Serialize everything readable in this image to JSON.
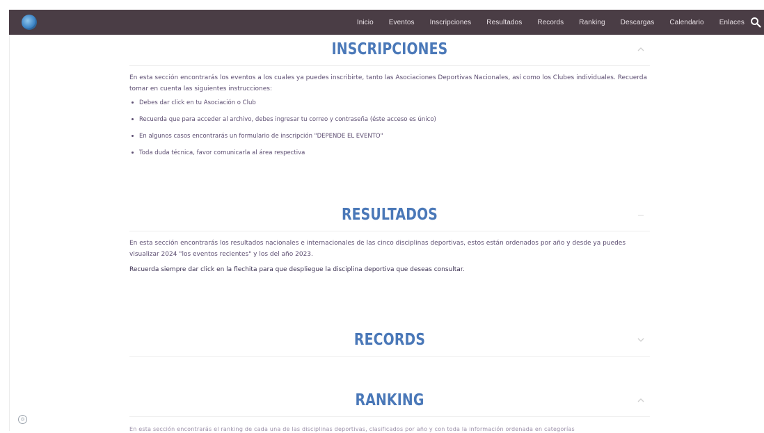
{
  "nav": {
    "logo": "globe-logo",
    "items": [
      {
        "label": "Inicio"
      },
      {
        "label": "Eventos"
      },
      {
        "label": "Inscripciones"
      },
      {
        "label": "Resultados"
      },
      {
        "label": "Records"
      },
      {
        "label": "Ranking"
      },
      {
        "label": "Descargas"
      },
      {
        "label": "Calendario"
      },
      {
        "label": "Enlaces"
      }
    ],
    "search_icon": "search-icon"
  },
  "sections": {
    "inscripciones": {
      "title": "INSCRIPCIONES",
      "intro": "En esta sección encontrarás los eventos a los cuales ya puedes inscribirte, tanto las Asociaciones Deportivas Nacionales, así como los Clubes individuales. Recuerda tomar en cuenta las siguientes instrucciones:",
      "bullets": [
        "Debes dar click en tu Asociación o Club",
        "Recuerda que para acceder al archivo, debes ingresar tu correo y contraseña (éste acceso es único)",
        "En algunos casos encontrarás un formulario de inscripción \"DEPENDE EL EVENTO\"",
        "Toda duda técnica, favor comunicarla al área respectiva"
      ]
    },
    "resultados": {
      "title": "RESULTADOS",
      "intro": "En esta sección encontrarás los resultados nacionales e internacionales de las cinco disciplinas deportivas, estos están ordenados por año y desde ya puedes visualizar 2024 \"los eventos recientes\" y los del año 2023.",
      "note": "Recuerda siempre dar click en la flechita para que despliegue la disciplina deportiva que deseas consultar."
    },
    "records": {
      "title": "RECORDS"
    },
    "ranking": {
      "title": "RANKING",
      "cut_text": "En esta sección encontrarás el ranking de cada una de las disciplinas deportivas, clasificados por año y con toda la información ordenada en categorías"
    }
  },
  "colors": {
    "nav_bg": "#4a3d45",
    "title_blue": "#4a78b8",
    "text_purple": "#5d4e72"
  }
}
